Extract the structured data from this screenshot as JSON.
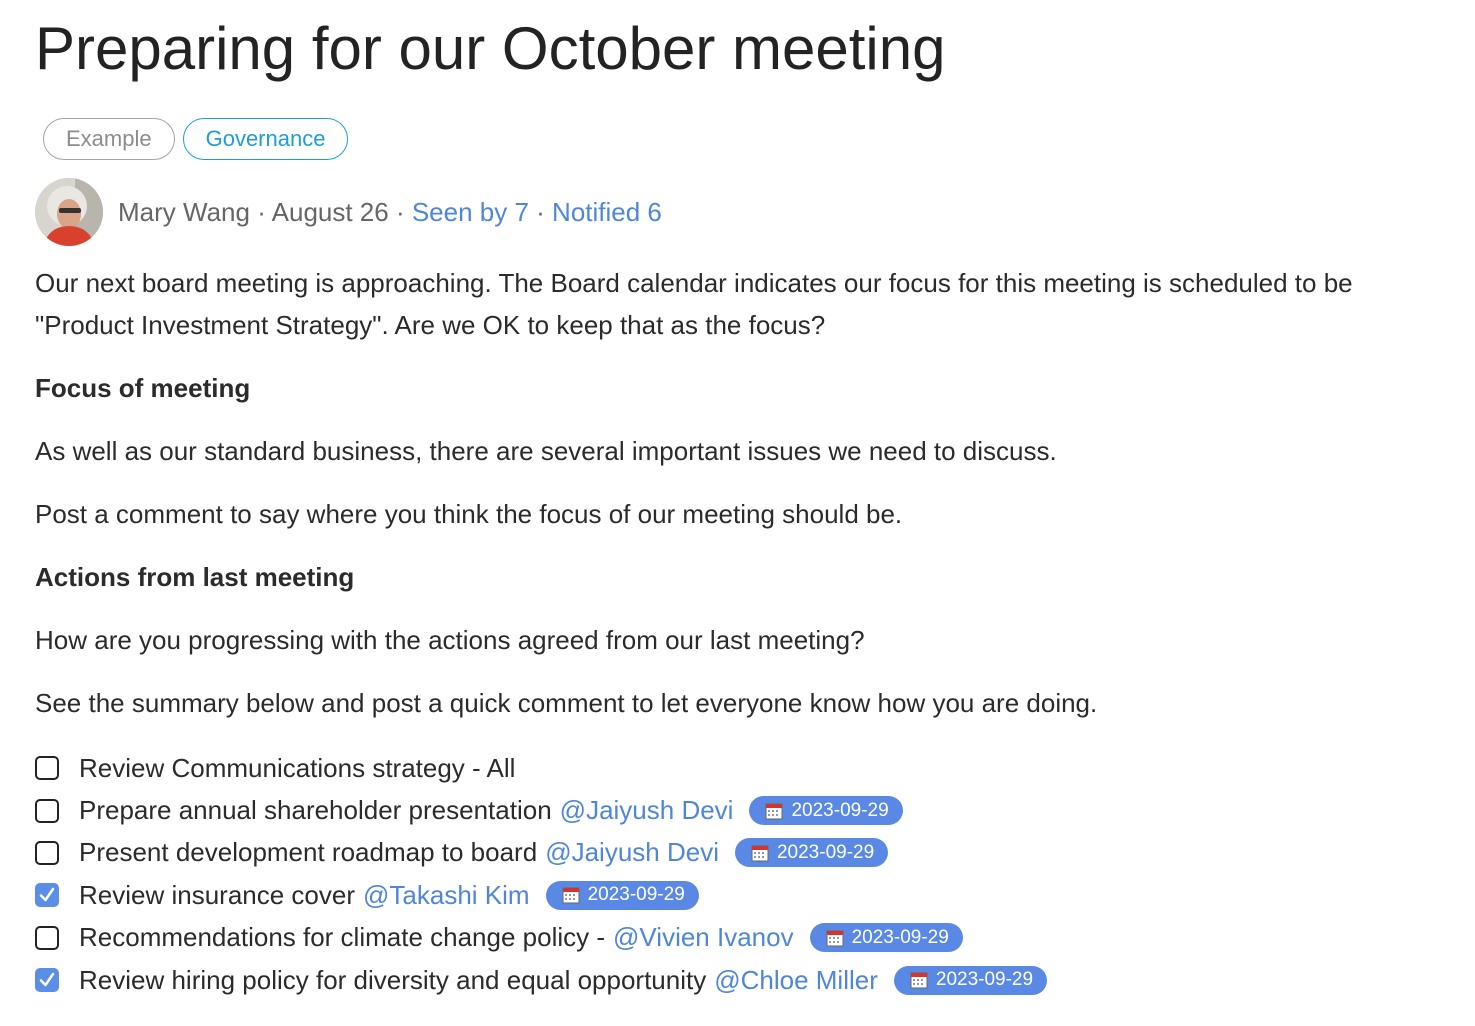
{
  "post": {
    "title": "Preparing for our October meeting",
    "tags": [
      "Example",
      "Governance"
    ],
    "author": "Mary Wang",
    "date": "August 26",
    "separator": " · ",
    "seen_by": "Seen by 7",
    "notified": "Notified 6"
  },
  "content": {
    "intro": "Our next board meeting is approaching. The Board calendar indicates our focus for this meeting is scheduled to be \"Product Investment Strategy\". Are we OK to keep that as the focus?",
    "heading_focus": "Focus of meeting",
    "focus_p1": "As well as our standard business, there are several important issues we need to discuss.",
    "focus_p2": "Post a comment to say where you think the focus of our meeting should be.",
    "heading_actions": "Actions from last meeting",
    "actions_p1": "How are you progressing with the actions agreed from our last meeting?",
    "actions_p2": "See the summary below and post a quick comment to let everyone know how you are doing."
  },
  "checklist": [
    {
      "text": "Review Communications strategy - All",
      "mention": "",
      "date": "",
      "checked": false
    },
    {
      "text": "Prepare annual shareholder presentation",
      "mention": "@Jaiyush Devi",
      "date": "2023-09-29",
      "checked": false
    },
    {
      "text": "Present development roadmap to board",
      "mention": "@Jaiyush Devi",
      "date": "2023-09-29",
      "checked": false
    },
    {
      "text": "Review insurance cover",
      "mention": "@Takashi Kim",
      "date": "2023-09-29",
      "checked": true
    },
    {
      "text": "Recommendations for climate change policy -",
      "mention": "@Vivien Ivanov",
      "date": "2023-09-29",
      "checked": false
    },
    {
      "text": "Review hiring policy for diversity and equal opportunity",
      "mention": "@Chloe Miller",
      "date": "2023-09-29",
      "checked": true
    }
  ],
  "colors": {
    "accent": "#4f86d9",
    "badge": "#5a89e5",
    "governance": "#1e9ed8",
    "checkbox_checked": "#5b8ee6"
  },
  "icons": {
    "calendar": "calendar-icon",
    "check": "checkmark-icon"
  }
}
